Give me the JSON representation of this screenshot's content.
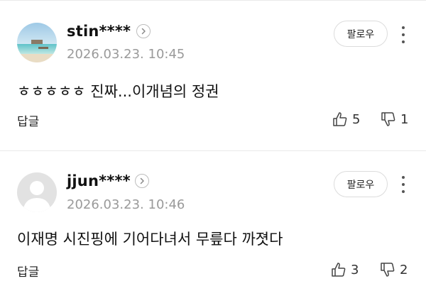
{
  "comments": [
    {
      "username": "stin****",
      "timestamp": "2026.03.23. 10:45",
      "text": "ㅎㅎㅎㅎㅎ 진짜...이개념의 정권",
      "follow_label": "팔로우",
      "reply_label": "답글",
      "likes": "5",
      "dislikes": "1",
      "avatar": "beach-photo"
    },
    {
      "username": "jjun****",
      "timestamp": "2026.03.23. 10:46",
      "text": "이재명 시진핑에 기어다녀서 무릎다 까졋다",
      "follow_label": "팔로우",
      "reply_label": "답글",
      "likes": "3",
      "dislikes": "2",
      "avatar": "default-user"
    }
  ],
  "icons": {
    "profile": "chevron-right-icon",
    "more": "more-vertical-icon",
    "like": "thumbs-up-icon",
    "dislike": "thumbs-down-icon"
  },
  "colors": {
    "text": "#111111",
    "muted": "#9a9a9a",
    "border": "#dcdcdc",
    "divider": "#e9e9e9"
  }
}
